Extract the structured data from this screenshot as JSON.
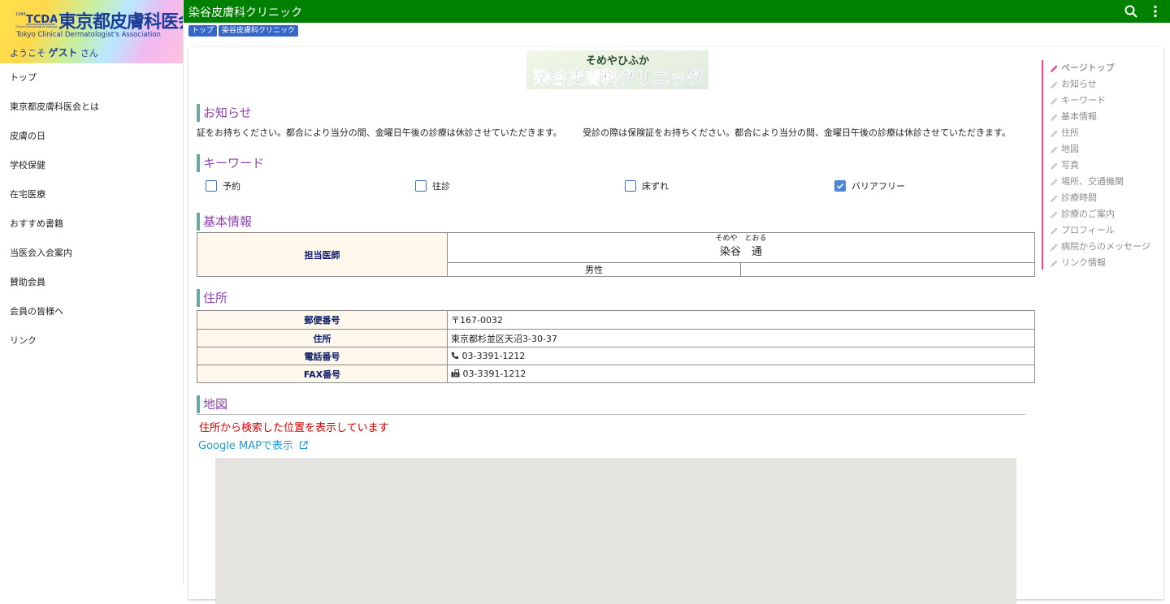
{
  "brand": {
    "logo_text": "TCDA",
    "name": "東京都皮膚科医会",
    "subtitle": "Tokyo Clinical Dermatologist's Association",
    "welcome_prefix": "ようこそ",
    "welcome_user": "ゲスト",
    "welcome_suffix": "さん"
  },
  "sidebar": {
    "items": [
      {
        "label": "トップ"
      },
      {
        "label": "東京都皮膚科医会とは"
      },
      {
        "label": "皮膚の日"
      },
      {
        "label": "学校保健"
      },
      {
        "label": "在宅医療"
      },
      {
        "label": "おすすめ書籍"
      },
      {
        "label": "当医会入会案内"
      },
      {
        "label": "賛助会員"
      },
      {
        "label": "会員の皆様へ"
      },
      {
        "label": "リンク"
      }
    ]
  },
  "appbar": {
    "title": "染谷皮膚科クリニック",
    "color": "#008000"
  },
  "breadcrumb": [
    "トップ",
    "染谷皮膚科クリニック"
  ],
  "banner": {
    "kana": "そめやひふか",
    "title": "染谷皮膚科クリニック"
  },
  "notice": {
    "heading": "お知らせ",
    "text1": "証をお持ちください。都合により当分の間、金曜日午後の診療は休診させていただきます。",
    "text2": "受診の際は保険証をお持ちください。都合により当分の間、金曜日午後の診療は休診させていただきます。"
  },
  "keywords": {
    "heading": "キーワード",
    "items": [
      {
        "label": "予約",
        "checked": false
      },
      {
        "label": "往診",
        "checked": false
      },
      {
        "label": "床ずれ",
        "checked": false
      },
      {
        "label": "バリアフリー",
        "checked": true
      }
    ]
  },
  "basic": {
    "heading": "基本情報",
    "doctor_label": "担当医師",
    "doctor_kana": "そめや　とおる",
    "doctor_name": "染谷　通",
    "gender": "男性"
  },
  "address": {
    "heading": "住所",
    "rows": [
      {
        "label": "郵便番号",
        "value": "〒167-0032"
      },
      {
        "label": "住所",
        "value": "東京都杉並区天沼3-30-37"
      },
      {
        "label": "電話番号",
        "value": "03-3391-1212"
      },
      {
        "label": "FAX番号",
        "value": "03-3391-1212"
      }
    ]
  },
  "map": {
    "heading": "地図",
    "note": "住所から検索した位置を表示しています",
    "link_label": "Google MAPで表示"
  },
  "toc": {
    "items": [
      {
        "label": "ページトップ",
        "active": true
      },
      {
        "label": "お知らせ"
      },
      {
        "label": "キーワード"
      },
      {
        "label": "基本情報"
      },
      {
        "label": "住所"
      },
      {
        "label": "地図"
      },
      {
        "label": "写真"
      },
      {
        "label": "場所、交通機関"
      },
      {
        "label": "診療時間"
      },
      {
        "label": "診療のご案内"
      },
      {
        "label": "プロフィール"
      },
      {
        "label": "病院からのメッセージ"
      },
      {
        "label": "リンク情報"
      }
    ]
  },
  "colors": {
    "accent_heading": "#8e44ad",
    "toc_line": "#e84a8a",
    "breadcrumb": "#3566c8",
    "map_note": "#d40000",
    "link": "#1a9bd7"
  }
}
